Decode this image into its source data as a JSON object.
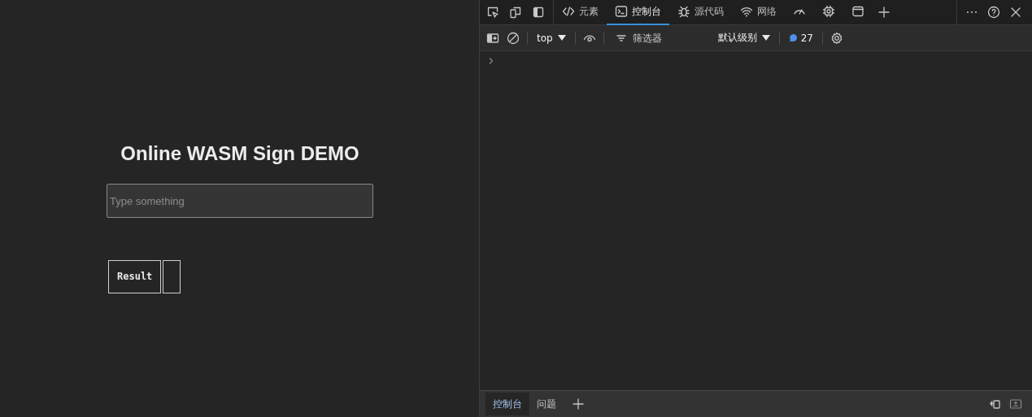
{
  "page": {
    "title": "Online WASM Sign DEMO",
    "input": {
      "placeholder": "Type something"
    },
    "result": {
      "label": "Result"
    }
  },
  "devtools": {
    "tabs": [
      {
        "kind": "elements",
        "label": "元素",
        "selected": false
      },
      {
        "kind": "console",
        "label": "控制台",
        "selected": true
      },
      {
        "kind": "sources",
        "label": "源代码",
        "selected": false
      },
      {
        "kind": "network",
        "label": "网络",
        "selected": false
      },
      {
        "kind": "performance",
        "selected": false
      },
      {
        "kind": "memory",
        "selected": false
      },
      {
        "kind": "application",
        "selected": false
      }
    ],
    "console_toolbar": {
      "context": "top",
      "filter": {
        "placeholder": "筛选器"
      },
      "levels": "默认级别",
      "issues_count": "27"
    },
    "drawer_tabs": [
      {
        "label": "控制台",
        "selected": true
      },
      {
        "label": "问题",
        "selected": false
      }
    ]
  }
}
